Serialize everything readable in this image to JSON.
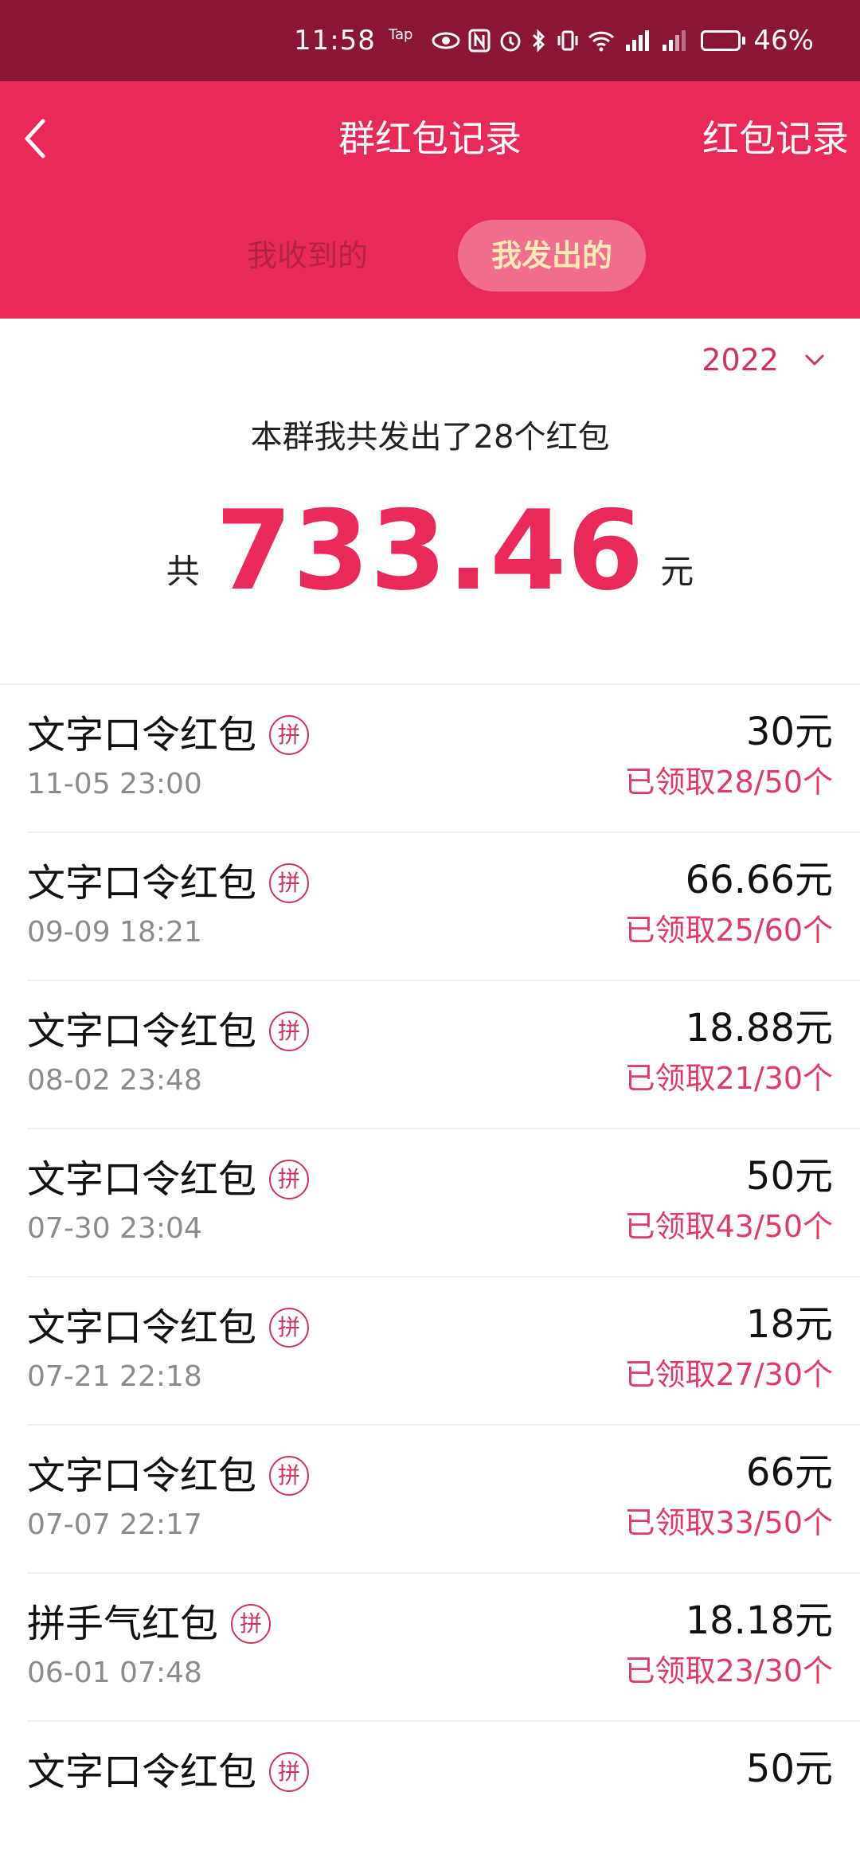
{
  "status_bar": {
    "time": "11:58",
    "tap_label": "Tap",
    "battery": "46%",
    "battery_level": 0.46
  },
  "header": {
    "title": "群红包记录",
    "right_link": "红包记录",
    "tabs": [
      {
        "label": "我收到的",
        "active": false
      },
      {
        "label": "我发出的",
        "active": true
      }
    ],
    "accent_color": "#e8295a"
  },
  "year_selector": {
    "year": "2022"
  },
  "summary": {
    "text": "本群我共发出了28个红包",
    "prefix": "共",
    "amount": "733.46",
    "suffix": "元"
  },
  "records": [
    {
      "name": "文字口令红包",
      "badge": "拼",
      "date": "11-05 23:00",
      "amount": "30元",
      "claimed": "已领取28/50个"
    },
    {
      "name": "文字口令红包",
      "badge": "拼",
      "date": "09-09 18:21",
      "amount": "66.66元",
      "claimed": "已领取25/60个"
    },
    {
      "name": "文字口令红包",
      "badge": "拼",
      "date": "08-02 23:48",
      "amount": "18.88元",
      "claimed": "已领取21/30个"
    },
    {
      "name": "文字口令红包",
      "badge": "拼",
      "date": "07-30 23:04",
      "amount": "50元",
      "claimed": "已领取43/50个"
    },
    {
      "name": "文字口令红包",
      "badge": "拼",
      "date": "07-21 22:18",
      "amount": "18元",
      "claimed": "已领取27/30个"
    },
    {
      "name": "文字口令红包",
      "badge": "拼",
      "date": "07-07 22:17",
      "amount": "66元",
      "claimed": "已领取33/50个"
    },
    {
      "name": "拼手气红包",
      "badge": "拼",
      "date": "06-01 07:48",
      "amount": "18.18元",
      "claimed": "已领取23/30个"
    },
    {
      "name": "文字口令红包",
      "badge": "拼",
      "date": "",
      "amount": "50元",
      "claimed": ""
    }
  ]
}
